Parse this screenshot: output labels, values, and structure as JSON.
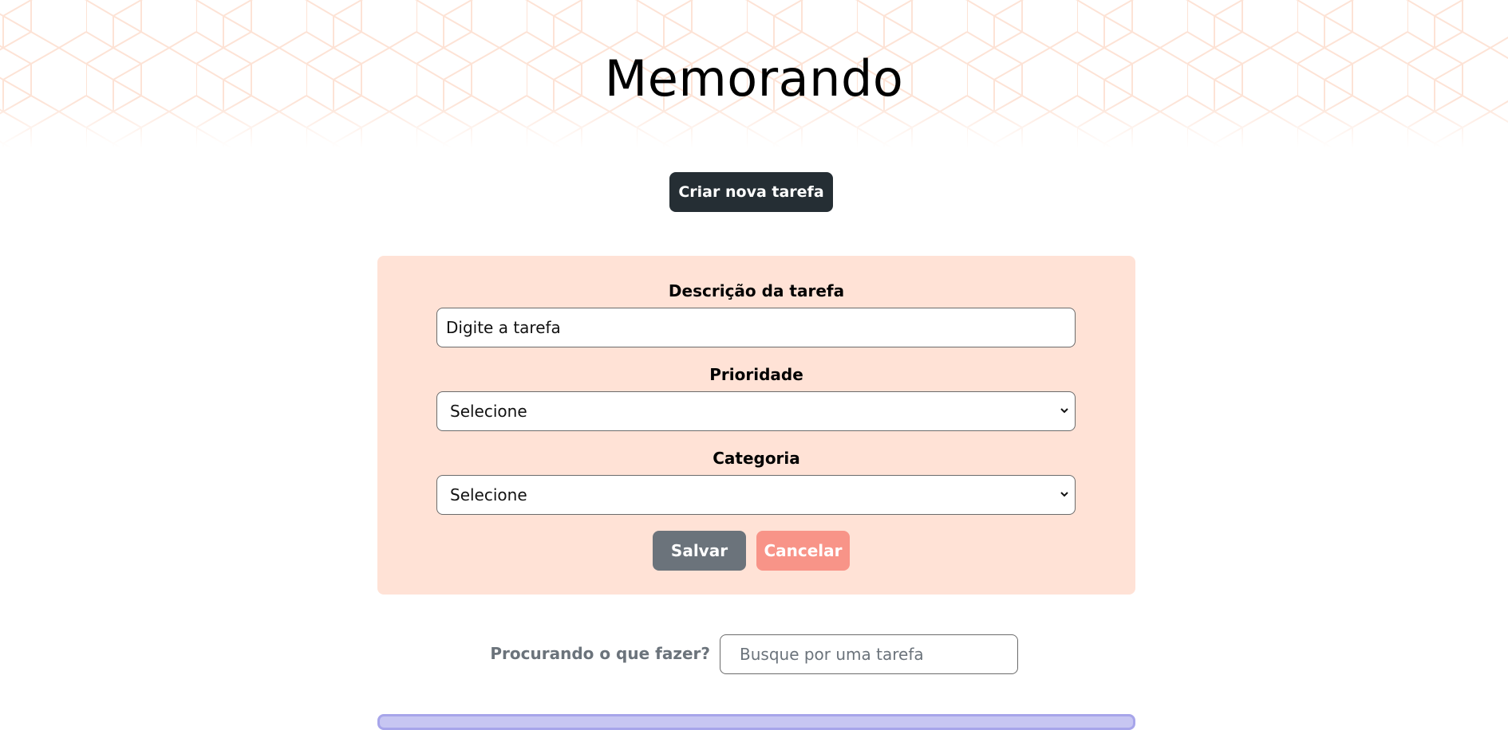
{
  "header": {
    "title": "Memorando"
  },
  "create_button": {
    "label": "Criar nova tarefa"
  },
  "form": {
    "description": {
      "label": "Descrição da tarefa",
      "placeholder": "Digite a tarefa"
    },
    "priority": {
      "label": "Prioridade",
      "selected": "Selecione"
    },
    "category": {
      "label": "Categoria",
      "selected": "Selecione"
    },
    "save_label": "Salvar",
    "cancel_label": "Cancelar"
  },
  "search": {
    "label": "Procurando o que fazer?",
    "placeholder": "Busque por uma tarefa"
  },
  "colors": {
    "primary_dark": "#252e34",
    "form_bg": "#ffe2d6",
    "save": "#6b737b",
    "cancel": "#f89488",
    "header_pattern": "#fde3d6",
    "list_card": "#c7c6f2"
  }
}
